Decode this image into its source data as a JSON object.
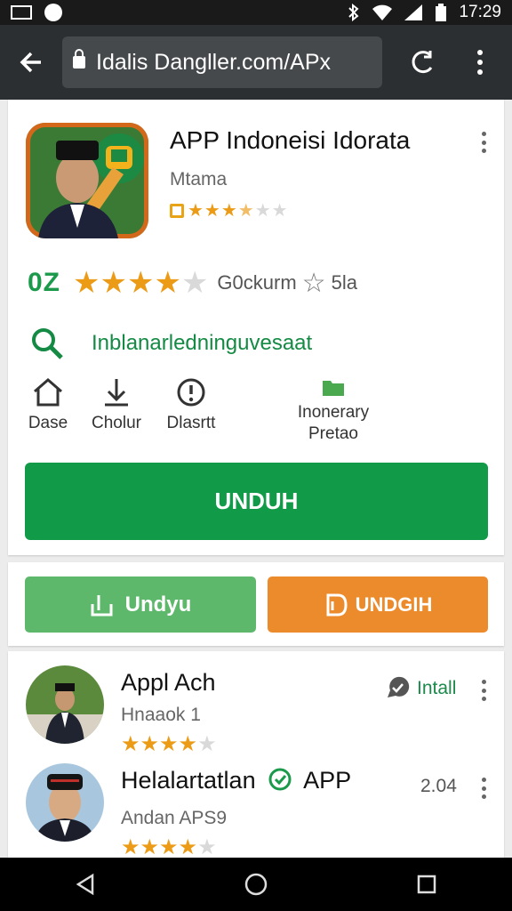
{
  "status_bar": {
    "time": "17:29"
  },
  "browser": {
    "url": "Idalis Dangller.com/APx"
  },
  "app": {
    "title": "APP Indoneisi Idorata",
    "developer": "Mtama",
    "small_rating_stars": 3.5,
    "score_label": "0Z",
    "rating_stars": 4,
    "rating_text": "G0ckurm",
    "rating_text2": "5la",
    "search_label": "Inblanarledninguvesaat",
    "actions": [
      {
        "label": "Dase",
        "icon": "home-icon"
      },
      {
        "label": "Cholur",
        "icon": "download-icon"
      },
      {
        "label": "Dlasrtt",
        "icon": "info-icon"
      },
      {
        "label": "Inonerary Pretao",
        "icon": "folder-icon"
      }
    ],
    "install_label": "UNDUH"
  },
  "buttons": {
    "green_label": "Undyu",
    "orange_label": "UNDGIH"
  },
  "list": [
    {
      "title": "Appl Ach",
      "subtitle": "Hnaaok 1",
      "stars": 4,
      "right_label": "Intall"
    },
    {
      "title": "Helalartatlan",
      "title_suffix": "APP",
      "subtitle": "Andan APS9",
      "stars": 4,
      "right_label": "2.04"
    }
  ],
  "colors": {
    "install_green": "#119a48",
    "accent_green": "#1b9a4c",
    "button_green": "#5db86b",
    "button_orange": "#ec8b2c",
    "star_gold": "#ec9b17"
  }
}
